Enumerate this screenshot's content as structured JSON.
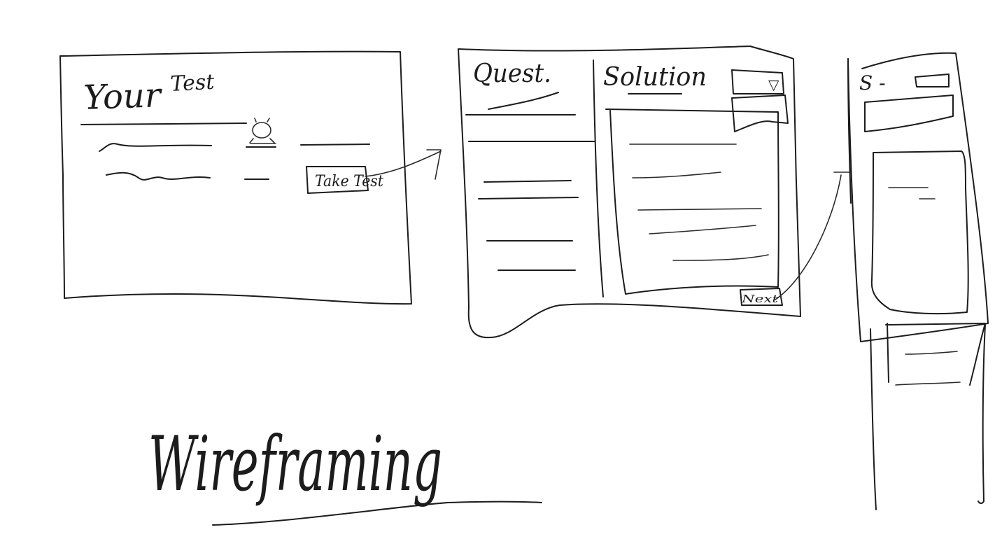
{
  "wireframe_1": {
    "title_main": "Your",
    "title_sub": "Test",
    "button_label": "Take Test"
  },
  "wireframe_2": {
    "left_heading": "Quest.",
    "right_heading": "Solution",
    "dropdown_symbol": "▽",
    "submit_label": "Next"
  },
  "wireframe_3": {
    "heading": "S -"
  },
  "caption": "Wireframing"
}
